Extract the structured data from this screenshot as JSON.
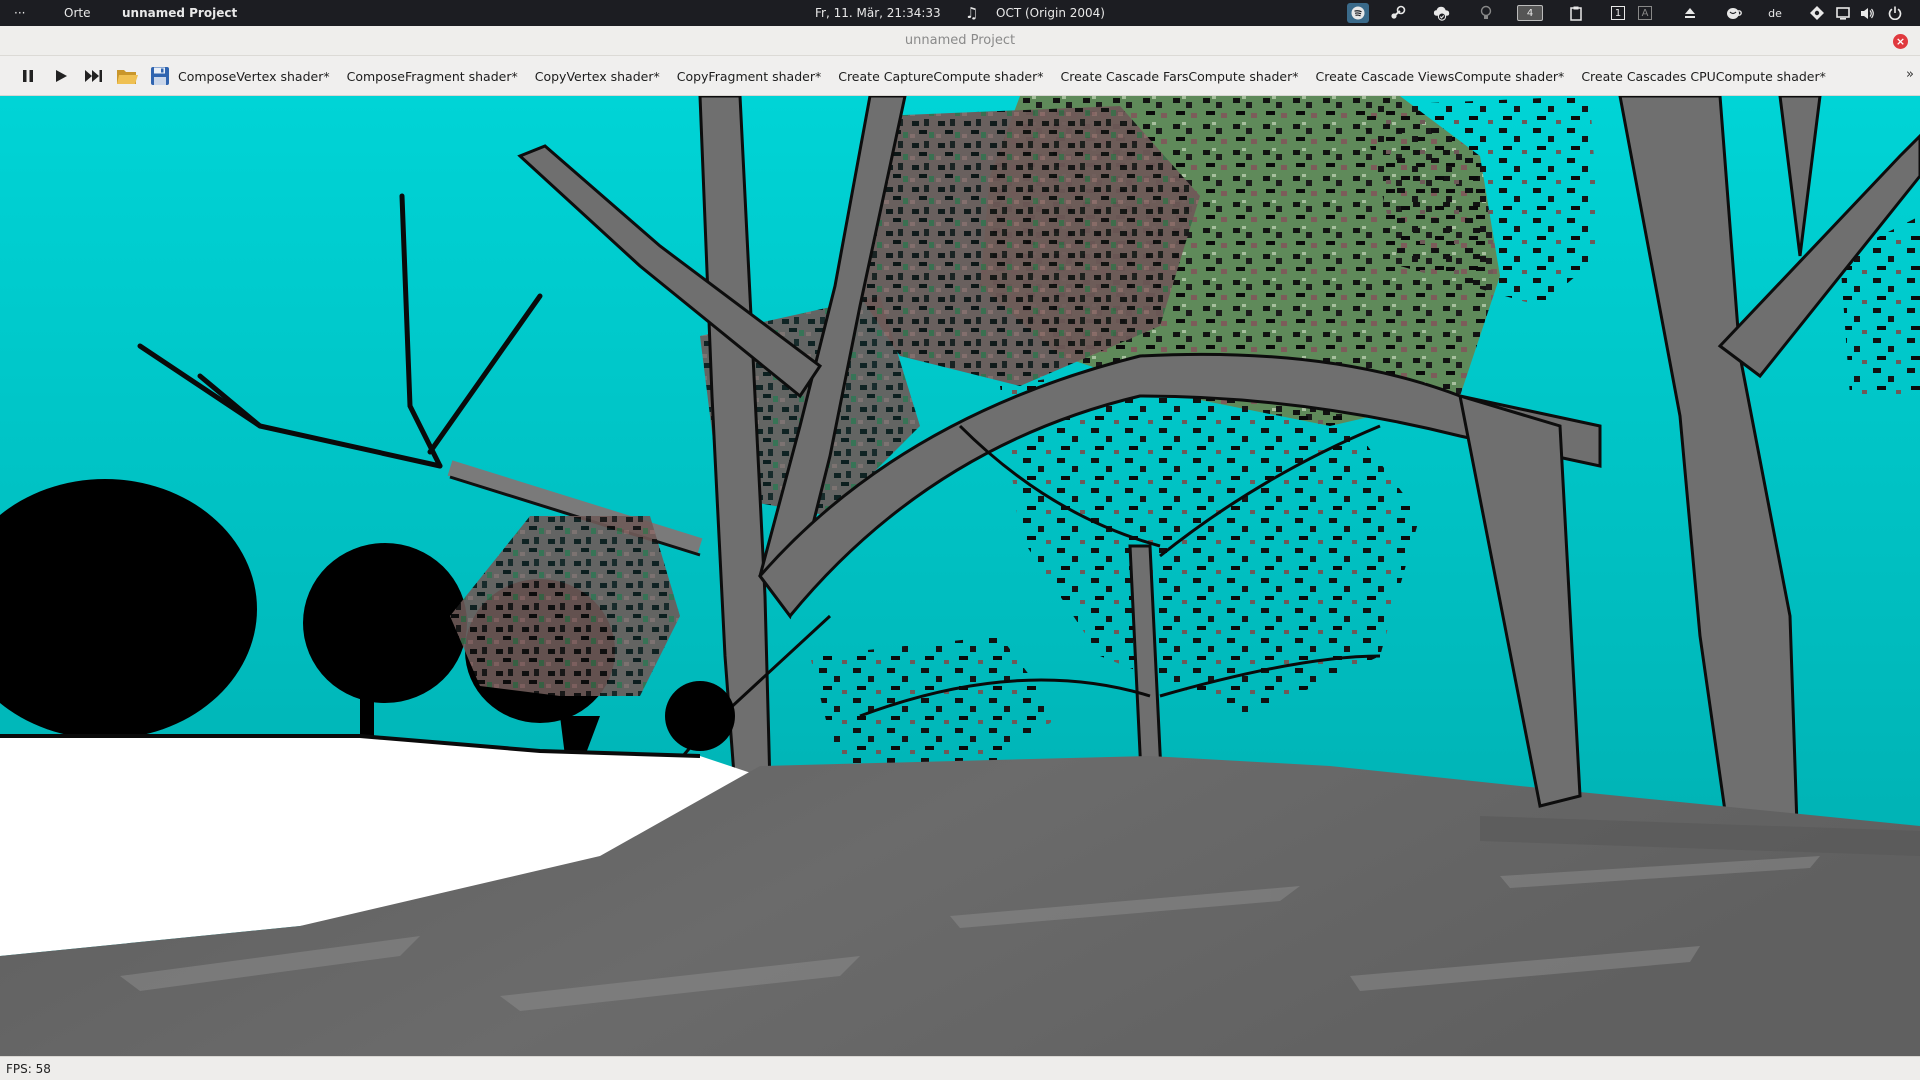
{
  "topbar": {
    "activities_label": "···",
    "places_label": "Orte",
    "app_name": "unnamed Project",
    "clock": "Fr, 11. Mär, 21:34:33",
    "music_label": "OCT (Origin 2004)",
    "workspace_number": "4",
    "workspace_a": "1",
    "workspace_b": "A",
    "keyboard_layout": "de",
    "icons": [
      "spotify-icon",
      "steam-icon",
      "cloud-check-icon",
      "bulb-icon",
      "clipboard-icon",
      "eject-icon",
      "coffee-icon",
      "network-icon",
      "display-icon",
      "volume-icon",
      "power-icon"
    ]
  },
  "window": {
    "title": "unnamed Project",
    "close_color": "#e0393e"
  },
  "toolbar": {
    "buttons": [
      "pause-icon",
      "play-icon",
      "skip-forward-icon",
      "open-folder-icon",
      "save-icon"
    ],
    "shader_tabs": [
      "ComposeVertex shader*",
      "ComposeFragment shader*",
      "CopyVertex shader*",
      "CopyFragment shader*",
      "Create CaptureCompute shader*",
      "Create Cascade FarsCompute shader*",
      "Create Cascade ViewsCompute shader*",
      "Create Cascades CPUCompute shader*"
    ],
    "overflow_label": "»"
  },
  "scene": {
    "sky_top_color": "#00d4d6",
    "sky_bottom_color": "#00a9ab",
    "trunk_color": "#6f6f6f",
    "ground_color": "#666666",
    "snow_color": "#ffffff"
  },
  "status": {
    "fps_label": "FPS: 58"
  }
}
